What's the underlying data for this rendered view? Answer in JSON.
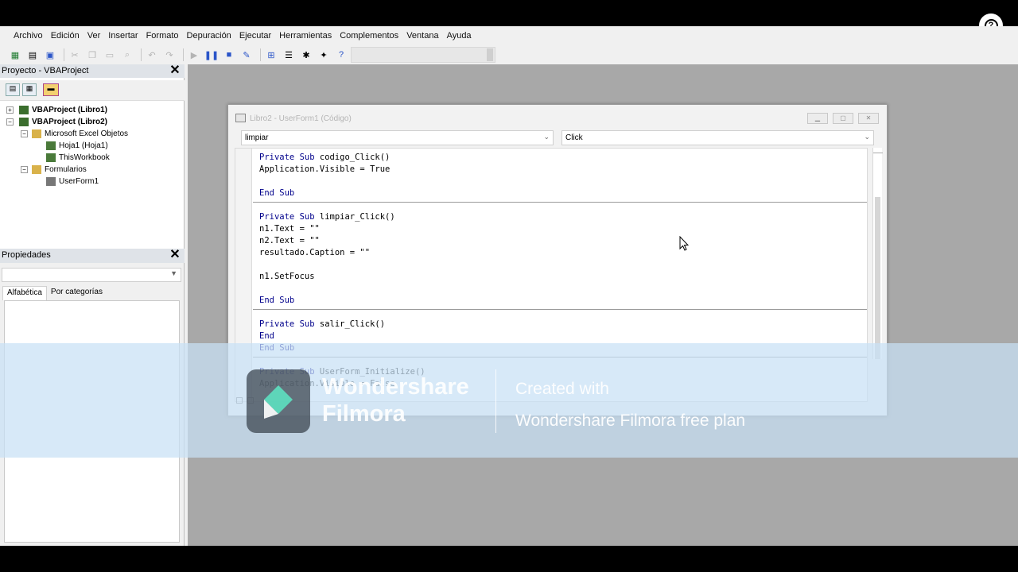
{
  "overlay": {
    "help_label": "?"
  },
  "menu": [
    "Archivo",
    "Edición",
    "Ver",
    "Insertar",
    "Formato",
    "Depuración",
    "Ejecutar",
    "Herramientas",
    "Complementos",
    "Ventana",
    "Ayuda"
  ],
  "project_pane": {
    "title": "Proyecto - VBAProject",
    "close_label": "✕",
    "tree": [
      {
        "label": "VBAProject (Libro1)",
        "bold": true
      },
      {
        "label": "VBAProject (Libro2)",
        "bold": true
      },
      {
        "label": "Microsoft Excel Objetos",
        "bold": false
      },
      {
        "label": "Hoja1 (Hoja1)",
        "bold": false
      },
      {
        "label": "ThisWorkbook",
        "bold": false
      },
      {
        "label": "Formularios",
        "bold": false
      },
      {
        "label": "UserForm1",
        "bold": false
      }
    ]
  },
  "properties_pane": {
    "title": "Propiedades",
    "close_label": "✕",
    "tabs": [
      "Alfabética",
      "Por categorías"
    ]
  },
  "code_window": {
    "title": "Libro2 - UserForm1 (Código)",
    "object_combo": "limpiar",
    "procedure_combo": "Click",
    "lines": [
      "Private Sub codigo_Click()",
      "Application.Visible = True",
      "",
      "End Sub",
      "",
      "Private Sub limpiar_Click()",
      "n1.Text = \"\"",
      "n2.Text = \"\"",
      "resultado.Caption = \"\"",
      "",
      "n1.SetFocus",
      "",
      "End Sub",
      "",
      "Private Sub salir_Click()",
      "End",
      "End Sub",
      "",
      "Private Sub UserForm_Initialize()",
      "Application.Visible = False"
    ]
  },
  "watermark": {
    "brand_line1": "Wondershare",
    "brand_line2": "Filmora",
    "text_line1": "Created with",
    "text_line2": "Wondershare Filmora free plan"
  },
  "colors": {
    "keyword": "#00008b",
    "mdi_background": "#a8a8a8",
    "pane_title": "#dfe3e8"
  }
}
